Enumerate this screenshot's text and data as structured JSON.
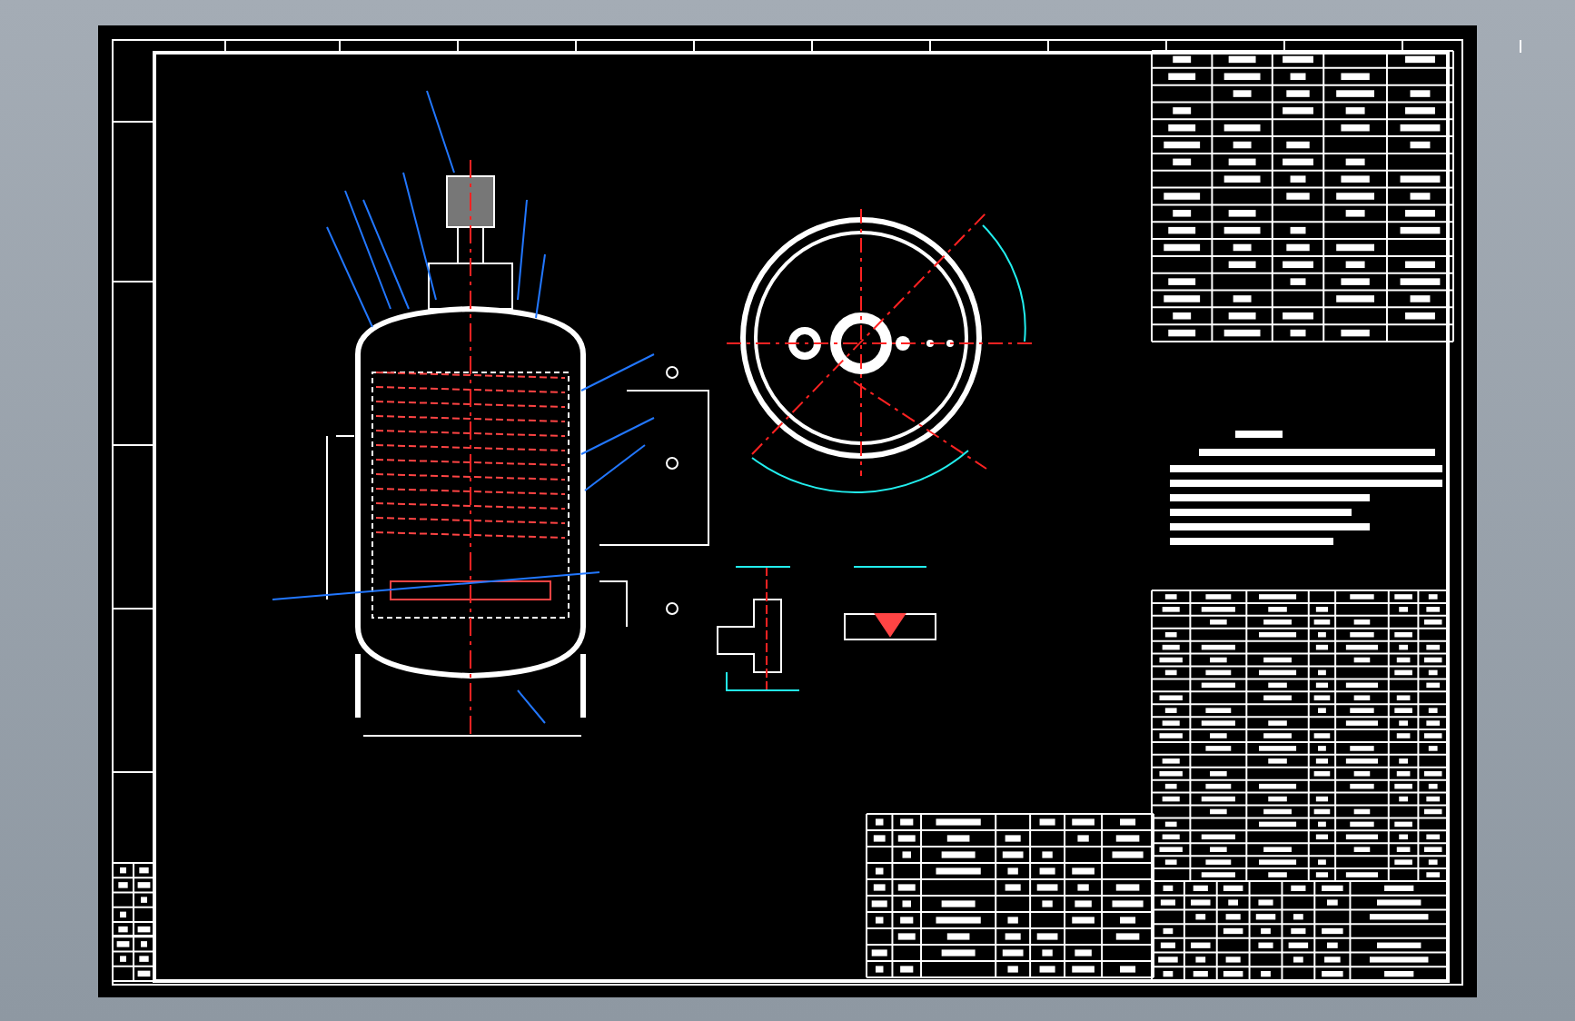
{
  "drawing": {
    "views": [
      {
        "kind": "elevation"
      },
      {
        "kind": "plan"
      },
      {
        "kind": "flange-detail"
      },
      {
        "kind": "weld-detail"
      }
    ],
    "tables": [
      {
        "kind": "design-data"
      },
      {
        "kind": "notes"
      },
      {
        "kind": "parts-list"
      },
      {
        "kind": "nozzle-table"
      },
      {
        "kind": "title-block"
      },
      {
        "kind": "revision-block"
      }
    ]
  }
}
